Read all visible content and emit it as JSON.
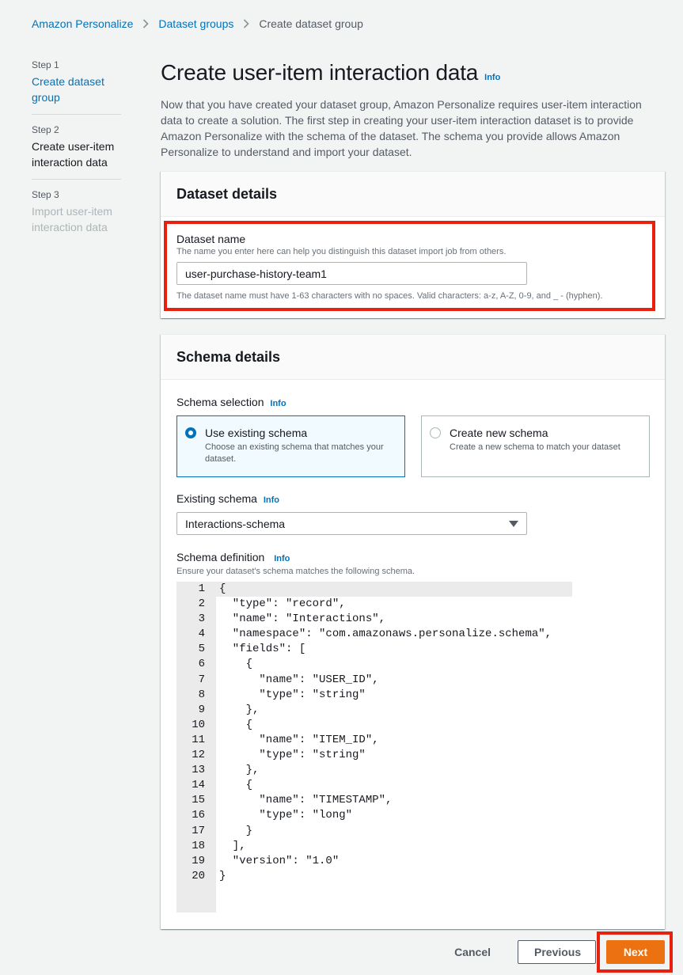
{
  "breadcrumb": {
    "items": [
      "Amazon Personalize",
      "Dataset groups"
    ],
    "current": "Create dataset group"
  },
  "steps": [
    {
      "number": "Step 1",
      "title": "Create dataset group"
    },
    {
      "number": "Step 2",
      "title": "Create user-item interaction data"
    },
    {
      "number": "Step 3",
      "title": "Import user-item interaction data"
    }
  ],
  "page": {
    "title": "Create user-item interaction data",
    "info": "Info",
    "description": "Now that you have created your dataset group, Amazon Personalize requires user-item interaction data to create a solution. The first step in creating your user-item interaction dataset is to provide Amazon Personalize with the schema of the dataset. The schema you provide allows Amazon Personalize to understand and import your dataset."
  },
  "dataset_details": {
    "header": "Dataset details",
    "name_label": "Dataset name",
    "name_desc": "The name you enter here can help you distinguish this dataset import job from others.",
    "name_value": "user-purchase-history-team1",
    "constraint": "The dataset name must have 1-63 characters with no spaces. Valid characters: a-z, A-Z, 0-9, and _ - (hyphen)."
  },
  "schema_details": {
    "header": "Schema details",
    "selection_label": "Schema selection",
    "info": "Info",
    "tiles": [
      {
        "title": "Use existing schema",
        "desc": "Choose an existing schema that matches your dataset.",
        "selected": true
      },
      {
        "title": "Create new schema",
        "desc": "Create a new schema to match your dataset",
        "selected": false
      }
    ],
    "existing_label": "Existing schema",
    "existing_value": "Interactions-schema",
    "definition_label": "Schema definition",
    "definition_desc": "Ensure your dataset's schema matches the following schema.",
    "code_lines": [
      "{",
      "  \"type\": \"record\",",
      "  \"name\": \"Interactions\",",
      "  \"namespace\": \"com.amazonaws.personalize.schema\",",
      "  \"fields\": [",
      "    {",
      "      \"name\": \"USER_ID\",",
      "      \"type\": \"string\"",
      "    },",
      "    {",
      "      \"name\": \"ITEM_ID\",",
      "      \"type\": \"string\"",
      "    },",
      "    {",
      "      \"name\": \"TIMESTAMP\",",
      "      \"type\": \"long\"",
      "    }",
      "  ],",
      "  \"version\": \"1.0\"",
      "}"
    ]
  },
  "footer": {
    "cancel": "Cancel",
    "previous": "Previous",
    "next": "Next"
  },
  "colors": {
    "link": "#0073bb",
    "primary": "#ec7211",
    "highlight": "#e8210e"
  },
  "icons": {
    "breadcrumb_separator": "chevron-right-icon",
    "select_caret": "caret-down-icon"
  }
}
